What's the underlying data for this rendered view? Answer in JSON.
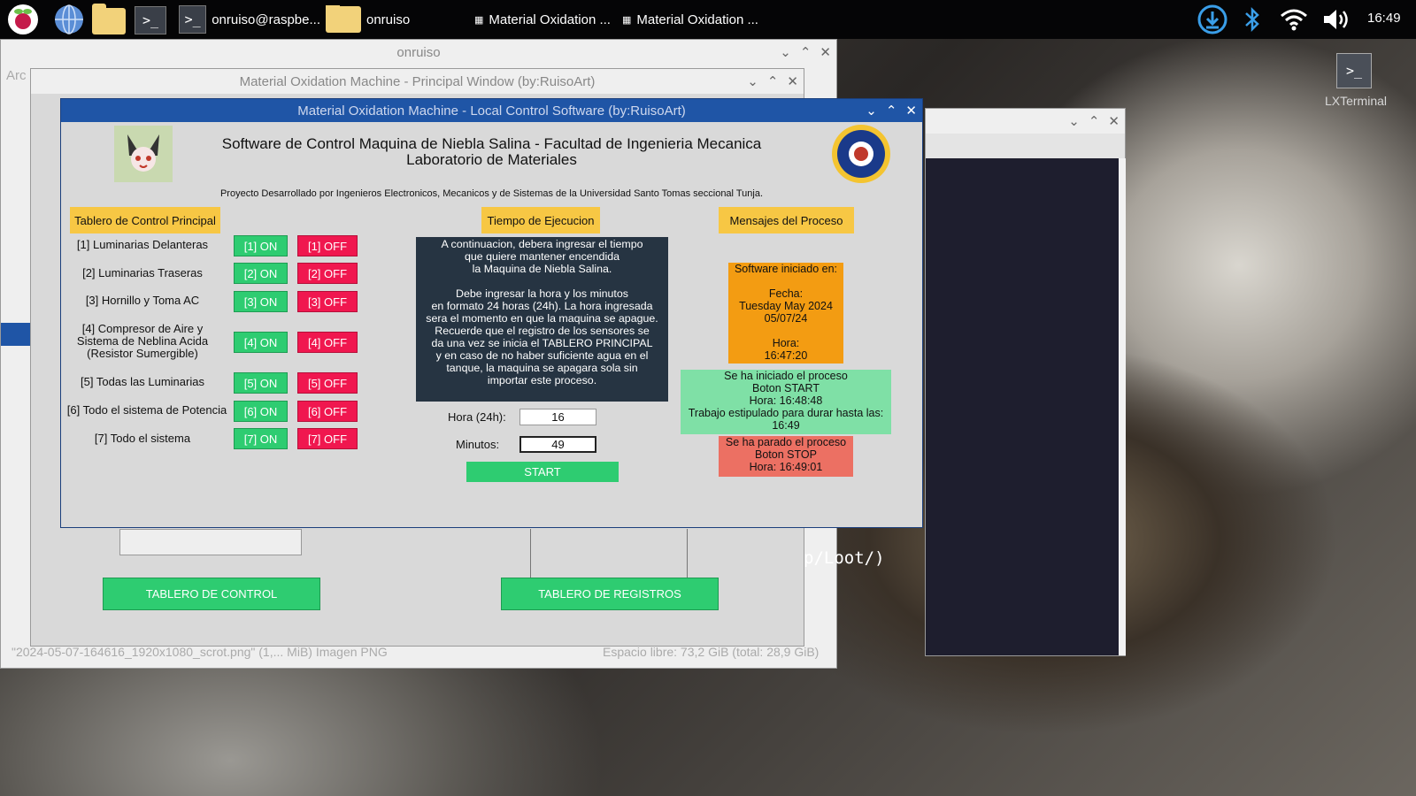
{
  "taskbar": {
    "terminal_task_label": "onruiso@raspbe...",
    "folder_task_label": "onruiso",
    "window_task_1_label": "Material Oxidation ...",
    "window_task_2_label": "Material Oxidation ...",
    "clock": "16:49"
  },
  "desktop": {
    "lxterminal_label": "LXTerminal"
  },
  "file_manager": {
    "title": "onruiso",
    "menu_fragment": "Arc",
    "status_left": "\"2024-05-07-164616_1920x1080_scrot.png\" (1,... MiB) Imagen PNG",
    "status_right": "Espacio libre: 73,2 GiB (total: 28,9 GiB)"
  },
  "terminal_window": {
    "visible_text": "p/Loot/)"
  },
  "principal_window": {
    "title": "Material Oxidation Machine - Principal Window (by:RuisoArt)",
    "tablero_control_label": "TABLERO DE CONTROL",
    "tablero_registros_label": "TABLERO DE REGISTROS"
  },
  "local_control": {
    "title": "Material Oxidation Machine - Local Control Software (by:RuisoArt)",
    "header_line1": "Software de Control Maquina de Niebla Salina - Facultad de Ingenieria Mecanica",
    "header_line2": "Laboratorio de Materiales",
    "subtitle": "Proyecto Desarrollado por Ingenieros Electronicos, Mecanicos y de Sistemas de la Universidad Santo Tomas seccional Tunja.",
    "section_control": "Tablero de Control Principal",
    "section_time": "Tiempo de Ejecucion",
    "section_messages": "Mensajes del Proceso",
    "rows": [
      {
        "label": "[1] Luminarias Delanteras",
        "on": "[1] ON",
        "off": "[1] OFF"
      },
      {
        "label": "[2] Luminarias Traseras",
        "on": "[2] ON",
        "off": "[2] OFF"
      },
      {
        "label": "[3] Hornillo y Toma AC",
        "on": "[3] ON",
        "off": "[3] OFF"
      },
      {
        "label": "[4] Compresor de Aire y\nSistema de Neblina Acida\n(Resistor Sumergible)",
        "on": "[4] ON",
        "off": "[4] OFF"
      },
      {
        "label": "[5] Todas las Luminarias",
        "on": "[5] ON",
        "off": "[5] OFF"
      },
      {
        "label": "[6] Todo el sistema de Potencia",
        "on": "[6] ON",
        "off": "[6] OFF"
      },
      {
        "label": "[7] Todo el sistema",
        "on": "[7] ON",
        "off": "[7] OFF"
      }
    ],
    "instructions": "A continuacion, debera ingresar el tiempo\nque quiere mantener encendida\nla Maquina de Niebla Salina.\n\nDebe ingresar la hora y los minutos\nen formato 24 horas (24h). La hora ingresada\nsera el momento en que la maquina se apague.\nRecuerde que el registro de los sensores se\nda una vez se inicia el TABLERO PRINCIPAL\ny en caso de no haber suficiente agua en el\ntanque, la maquina se apagara sola sin\nimportar este proceso.",
    "hour_label": "Hora (24h):",
    "hour_value": "16",
    "minutes_label": "Minutos:",
    "minutes_value": "49",
    "start_label": "START",
    "msg_started": "Software iniciado en:\n\nFecha:\nTuesday May 2024\n05/07/24\n\nHora:\n16:47:20",
    "msg_process_start": "Se ha iniciado el proceso\nBoton START\nHora: 16:48:48\nTrabajo estipulado para durar hasta las:\n16:49",
    "msg_process_stop": "Se ha parado el proceso\nBoton STOP\nHora: 16:49:01"
  },
  "colors": {
    "on_button": "#2ecc71",
    "off_button": "#f0174f",
    "section_label": "#f7c744",
    "msg_orange": "#f39c12",
    "msg_green": "#7fe0a6",
    "msg_red": "#ec7063",
    "titlebar_active": "#1f55a6"
  },
  "icons": [
    "raspberry-pi-icon",
    "globe-icon",
    "folder-icon",
    "terminal-icon",
    "download-icon",
    "bluetooth-icon",
    "wifi-icon",
    "volume-icon"
  ]
}
